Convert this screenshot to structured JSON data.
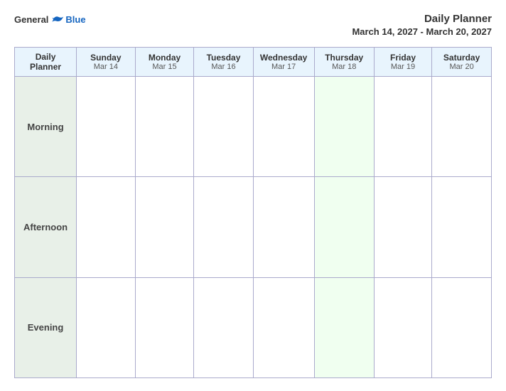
{
  "header": {
    "logo_general": "General",
    "logo_blue": "Blue",
    "title": "Daily Planner",
    "subtitle": "March 14, 2027 - March 20, 2027"
  },
  "table": {
    "label_header": "Daily\nPlanner",
    "columns": [
      {
        "day": "Sunday",
        "date": "Mar 14"
      },
      {
        "day": "Monday",
        "date": "Mar 15"
      },
      {
        "day": "Tuesday",
        "date": "Mar 16"
      },
      {
        "day": "Wednesday",
        "date": "Mar 17"
      },
      {
        "day": "Thursday",
        "date": "Mar 18"
      },
      {
        "day": "Friday",
        "date": "Mar 19"
      },
      {
        "day": "Saturday",
        "date": "Mar 20"
      }
    ],
    "rows": [
      {
        "label": "Morning"
      },
      {
        "label": "Afternoon"
      },
      {
        "label": "Evening"
      }
    ]
  }
}
